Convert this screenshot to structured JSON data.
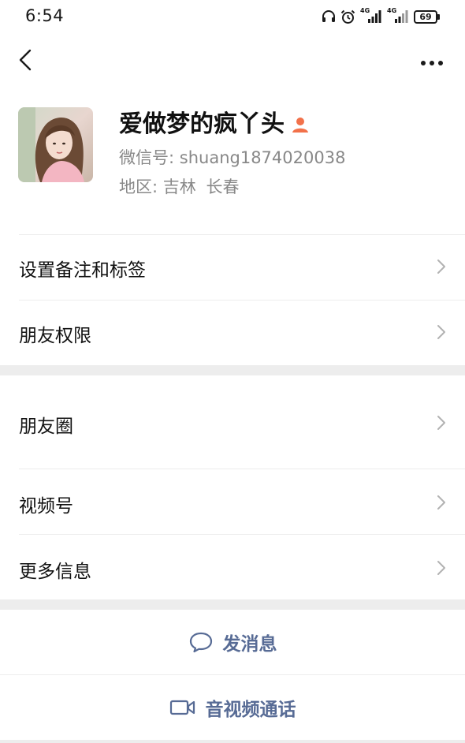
{
  "status_bar": {
    "time": "6:54",
    "network_1": "4G",
    "network_2": "4G",
    "battery": "69",
    "icons": [
      "headphones-icon",
      "alarm-icon",
      "signal-icon",
      "signal-icon",
      "battery-icon"
    ]
  },
  "nav": {
    "back_icon": "chevron-left-icon",
    "more_icon": "more-dots-icon"
  },
  "profile": {
    "name": "爱做梦的疯丫头",
    "gender_icon": "female-person-icon",
    "wechat_id_label": "微信号:",
    "wechat_id": "shuang1874020038",
    "region_label": "地区:",
    "region_province": "吉林",
    "region_city": "长春"
  },
  "section1": {
    "items": [
      {
        "label": "设置备注和标签"
      },
      {
        "label": "朋友权限"
      }
    ]
  },
  "section2": {
    "items": [
      {
        "label": "朋友圈"
      },
      {
        "label": "视频号"
      },
      {
        "label": "更多信息"
      }
    ]
  },
  "actions": {
    "send_message": "发消息",
    "av_call": "音视频通话"
  },
  "colors": {
    "link_blue": "#576b95",
    "gray_text": "#888888",
    "band": "#ededed",
    "gender_orange": "#f2714a"
  }
}
